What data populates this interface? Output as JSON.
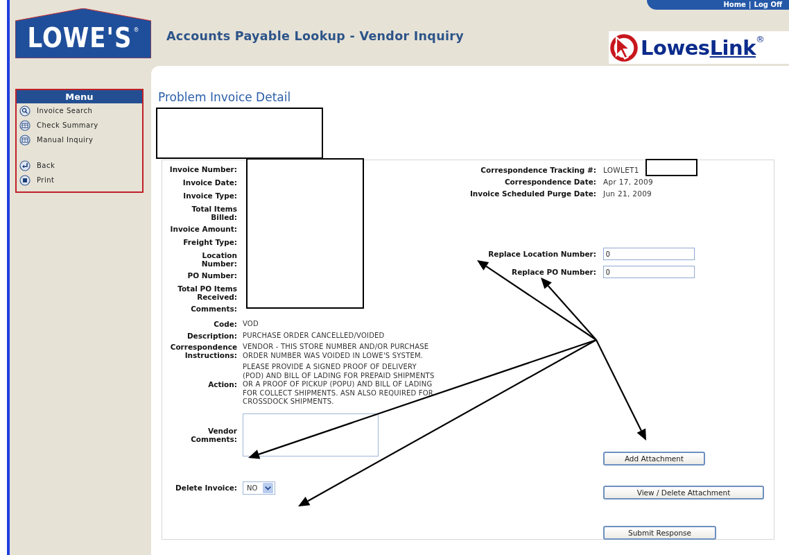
{
  "header": {
    "logo": "LOWE'S",
    "logo_mark": "®",
    "title": "Accounts Payable Lookup - Vendor Inquiry",
    "top_links": [
      "Home",
      "Log Off"
    ],
    "top_links_separator": "|",
    "portal_logo": {
      "part_1": "Lowes",
      "part_2": "Link",
      "mark": "®"
    }
  },
  "menu": {
    "title": "Menu",
    "items": [
      {
        "label": "Invoice Search",
        "kind": "search"
      },
      {
        "label": "Check Summary",
        "kind": "grid"
      },
      {
        "label": "Manual Inquiry",
        "kind": "grid"
      }
    ],
    "actions": [
      {
        "label": "Back",
        "kind": "back"
      },
      {
        "label": "Print",
        "kind": "print"
      }
    ]
  },
  "page_title": "Problem Invoice Detail",
  "invoice_fields": [
    {
      "label": "Invoice Number:"
    },
    {
      "label": "Invoice Date:"
    },
    {
      "label": "Invoice Type:"
    },
    {
      "label": "Total Items\nBilled:"
    },
    {
      "label": "Invoice Amount:"
    },
    {
      "label": "Freight Type:"
    },
    {
      "label": "Location\nNumber:"
    },
    {
      "label": "PO Number:"
    },
    {
      "label": "Total PO Items\nReceived:"
    },
    {
      "label": "Comments:"
    }
  ],
  "details": [
    {
      "label": "Code:",
      "value": "VOD"
    },
    {
      "label": "Description:",
      "value": "PURCHASE ORDER CANCELLED/VOIDED"
    },
    {
      "label": "Correspondence\nInstructions:",
      "value": "VENDOR - THIS STORE NUMBER AND/OR PURCHASE ORDER NUMBER WAS VOIDED IN LOWE'S SYSTEM."
    },
    {
      "label": "Action:",
      "value": "PLEASE PROVIDE A SIGNED PROOF OF DELIVERY (POD) AND BILL OF LADING FOR PREPAID SHIPMENTS OR A PROOF OF PICKUP (POPU) AND BILL OF LADING FOR COLLECT SHIPMENTS. ASN ALSO REQUIRED FOR CROSSDOCK SHIPMENTS."
    }
  ],
  "vendor_comments": {
    "label": "Vendor\nComments:"
  },
  "delete_invoice": {
    "label": "Delete Invoice:",
    "value": "NO"
  },
  "correspondence": [
    {
      "label": "Correspondence Tracking #:",
      "value": "LOWLET1"
    },
    {
      "label": "Correspondence Date:",
      "value": "Apr 17, 2009"
    },
    {
      "label": "Invoice Scheduled Purge Date:",
      "value": "Jun 21, 2009"
    }
  ],
  "replace_fields": [
    {
      "label": "Replace Location Number:",
      "value": "0"
    },
    {
      "label": "Replace PO Number:",
      "value": "0"
    }
  ],
  "buttons": [
    {
      "label": "Add Attachment"
    },
    {
      "label": "View / Delete Attachment"
    },
    {
      "label": "Submit Response"
    }
  ]
}
